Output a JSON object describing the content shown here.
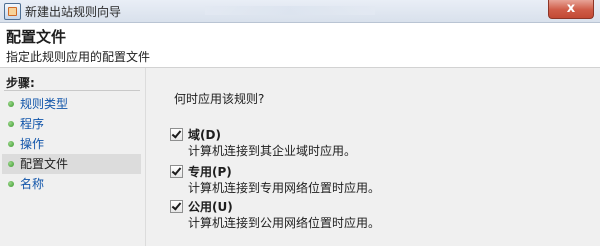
{
  "window": {
    "title": "新建出站规则向导",
    "close_symbol": "x"
  },
  "header": {
    "title": "配置文件",
    "subtitle": "指定此规则应用的配置文件"
  },
  "sidebar": {
    "heading": "步骤:",
    "steps": [
      {
        "label": "规则类型",
        "current": false
      },
      {
        "label": "程序",
        "current": false
      },
      {
        "label": "操作",
        "current": false
      },
      {
        "label": "配置文件",
        "current": true
      },
      {
        "label": "名称",
        "current": false
      }
    ]
  },
  "main": {
    "question": "何时应用该规则?",
    "options": [
      {
        "label": "域(D)",
        "checked": true,
        "description": "计算机连接到其企业域时应用。"
      },
      {
        "label": "专用(P)",
        "checked": true,
        "description": "计算机连接到专用网络位置时应用。"
      },
      {
        "label": "公用(U)",
        "checked": true,
        "description": "计算机连接到公用网络位置时应用。"
      }
    ]
  },
  "colors": {
    "link": "#1155aa",
    "step_dot": "#3a9a2c",
    "close_button": "#c24a35"
  }
}
